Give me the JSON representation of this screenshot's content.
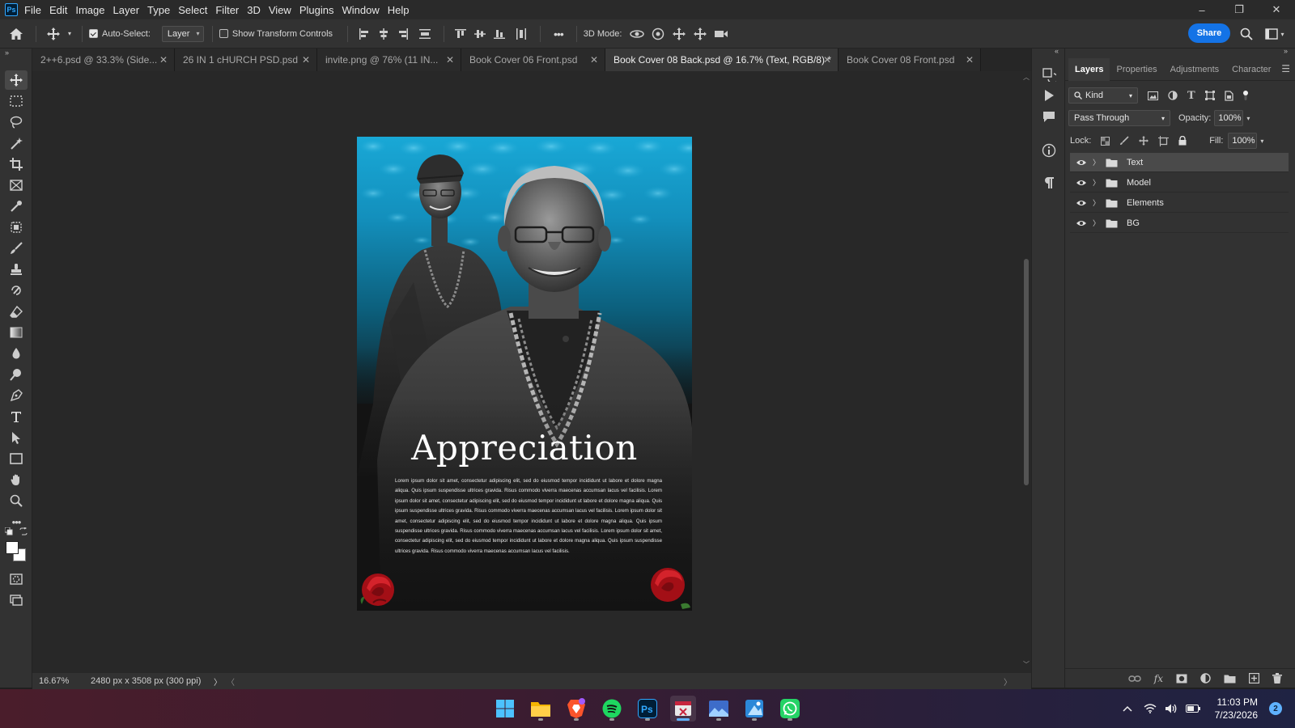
{
  "app": {
    "logo": "Ps"
  },
  "menu": [
    "File",
    "Edit",
    "Image",
    "Layer",
    "Type",
    "Select",
    "Filter",
    "3D",
    "View",
    "Plugins",
    "Window",
    "Help"
  ],
  "window_controls": {
    "minimize": "–",
    "restore": "❐",
    "close": "✕"
  },
  "options_bar": {
    "auto_select_label": "Auto-Select:",
    "auto_select_checked": true,
    "auto_select_target": "Layer",
    "show_transform_label": "Show Transform Controls",
    "show_transform_checked": false,
    "more": "•••",
    "mode_label": "3D Mode:",
    "share_label": "Share"
  },
  "tabs": [
    {
      "label": "2++6.psd @ 33.3% (Side...",
      "active": false
    },
    {
      "label": "26 IN 1 cHURCH PSD.psd",
      "active": false
    },
    {
      "label": "invite.png @ 76% (11 IN...",
      "active": false
    },
    {
      "label": "Book Cover 06 Front.psd",
      "active": false
    },
    {
      "label": "Book Cover 08 Back.psd @ 16.7% (Text, RGB/8) *",
      "active": true
    },
    {
      "label": "Book Cover 08 Front.psd",
      "active": false
    }
  ],
  "tab_close": "✕",
  "document": {
    "title": "Appreciation",
    "body": "Lorem ipsum dolor sit amet, consectetur adipiscing elit, sed do eiusmod tempor incididunt ut labore et dolore magna aliqua. Quis ipsum suspendisse ultrices gravida. Risus commodo viverra maecenas accumsan lacus vel facilisis. Lorem ipsum dolor sit amet, consectetur adipiscing elit, sed do eiusmod tempor incididunt ut labore et dolore magna aliqua. Quis ipsum suspendisse ultrices gravida. Risus commodo viverra maecenas accumsan lacus vel facilisis. Lorem ipsum dolor sit amet, consectetur adipiscing elit, sed do eiusmod tempor incididunt ut labore et dolore magna aliqua. Quis ipsum suspendisse ultrices gravida. Risus commodo viverra maecenas accumsan lacus vel facilisis. Lorem ipsum dolor sit amet, consectetur adipiscing elit, sed do eiusmod tempor incididunt ut labore et dolore magna aliqua. Quis ipsum suspendisse ultrices gravida. Risus commodo viverra maecenas accumsan lacus vel facilisis."
  },
  "status_bar": {
    "zoom": "16.67%",
    "doc_info": "2480 px x 3508 px (300 ppi)",
    "arrow": "〉",
    "left_arrow": "〈",
    "right_arrow": "〉"
  },
  "panel": {
    "tabs": [
      "Layers",
      "Properties",
      "Adjustments",
      "Character"
    ],
    "active_tab": "Layers",
    "filter_kind": "Kind",
    "blend_mode": "Pass Through",
    "opacity_label": "Opacity:",
    "opacity_value": "100%",
    "lock_label": "Lock:",
    "fill_label": "Fill:",
    "fill_value": "100%",
    "layers": [
      {
        "name": "Text",
        "selected": true,
        "visible": true
      },
      {
        "name": "Model",
        "selected": false,
        "visible": true
      },
      {
        "name": "Elements",
        "selected": false,
        "visible": true
      },
      {
        "name": "BG",
        "selected": false,
        "visible": true
      }
    ]
  },
  "taskbar": {
    "apps": [
      "windows-start-icon",
      "file-explorer-icon",
      "brave-browser-icon",
      "spotify-icon",
      "photoshop-icon",
      "snipping-tool-icon",
      "photos-icon",
      "paint-icon",
      "whatsapp-icon"
    ],
    "active_app": "snipping-tool-icon",
    "time": "11:03 PM",
    "date": "7/23/2026",
    "notifications": "2"
  },
  "colors": {
    "accent": "#1473e6",
    "poster_sky": "#19a8d6",
    "rose": "#c0151c"
  }
}
